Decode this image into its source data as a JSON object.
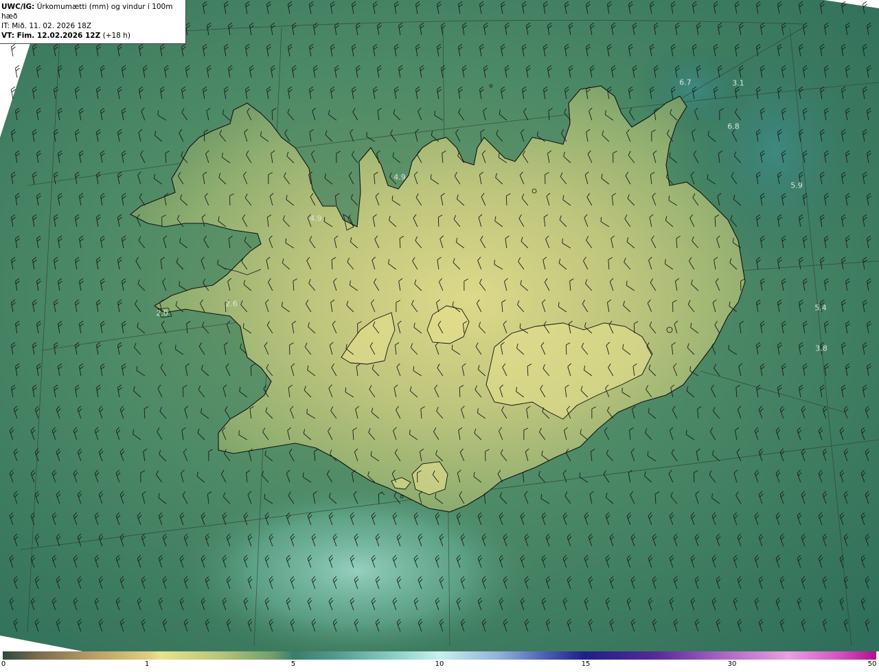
{
  "header": {
    "model": "UWC/IG:",
    "title": "Úrkomumætti (mm) og vindur í 100m hæð",
    "init_label": "IT:",
    "init_time": "Mið. 11. 02. 2026 18Z",
    "valid_label": "VT: Fim. 12.02.2026 12Z",
    "lead": "(+18 h)"
  },
  "value_labels": [
    "6.7",
    "3.1",
    "6.8",
    "5.9",
    "5.4",
    "3.8",
    "4.9",
    "4.9",
    "2.6",
    "2.0"
  ],
  "colorbar": {
    "ticks": [
      "0",
      "1",
      "5",
      "10",
      "15",
      "30",
      "50"
    ],
    "colors": [
      "#7d6a4e",
      "#e9e48a",
      "#3b7d6a",
      "#c8f0ee",
      "#1f1f8a",
      "#e8a0e0",
      "#b01090"
    ]
  },
  "colors": {
    "sea_dark": "#2f6e5a",
    "sea_mid": "#4a8a6a",
    "land_low": "#7aa06a",
    "land_high": "#e0dc8a",
    "coastline": "#111111",
    "barb": "#1a1a1a"
  }
}
